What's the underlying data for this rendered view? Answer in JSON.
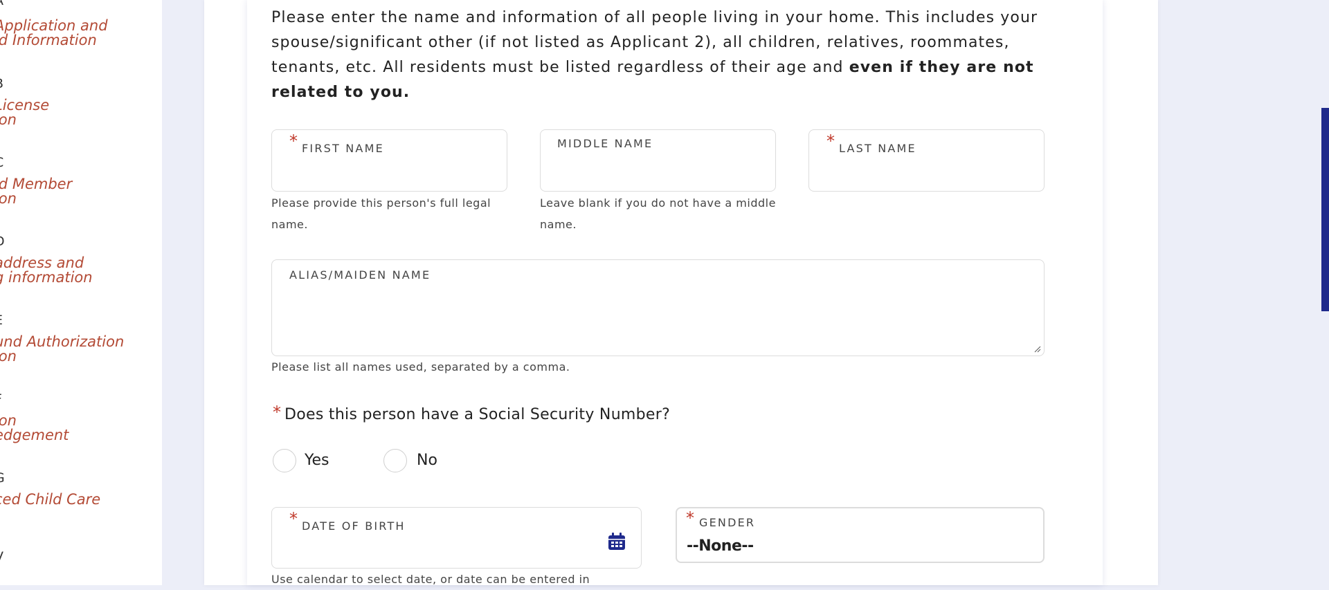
{
  "sidebar": {
    "steps": [
      {
        "letter": "A",
        "title": "Application and\nld Information"
      },
      {
        "letter": "B",
        "title": "License\nion"
      },
      {
        "letter": "C",
        "title": "ld Member\nion"
      },
      {
        "letter": "D",
        "title": "address and\ng information"
      },
      {
        "letter": "E",
        "title": "und Authorization\nion"
      },
      {
        "letter": "F",
        "title": "ion\nedgement"
      },
      {
        "letter": "G",
        "title": "ced Child Care"
      },
      {
        "letter": "V",
        "title": ""
      }
    ]
  },
  "intro": {
    "text": "Please enter the name and information of all people living in your home. This includes your spouse/significant other (if not listed as Applicant 2), all children, relatives, roommates, tenants, etc. All residents must be listed regardless of their age and ",
    "bold": "even if they are not related to you."
  },
  "fields": {
    "first_name": {
      "label": "FIRST NAME",
      "help": "Please provide this person's full legal name."
    },
    "middle_name": {
      "label": "MIDDLE NAME",
      "help": "Leave blank if you do not have a middle name."
    },
    "last_name": {
      "label": "LAST NAME"
    },
    "alias": {
      "label": "ALIAS/MAIDEN NAME",
      "help": "Please list all names used, separated by a comma."
    },
    "dob": {
      "label": "DATE OF BIRTH",
      "help": "Use calendar to select date, or date can be entered in"
    },
    "gender": {
      "label": "GENDER",
      "value": "--None--"
    }
  },
  "ssn_question": {
    "text": "Does this person have a Social Security Number?",
    "options": [
      "Yes",
      "No"
    ]
  },
  "required_marker": "*",
  "icons": {
    "calendar": "calendar-icon"
  },
  "colors": {
    "accent": "#1f2a8c",
    "required": "#c0392b",
    "sidebar_link": "#b34a35"
  }
}
